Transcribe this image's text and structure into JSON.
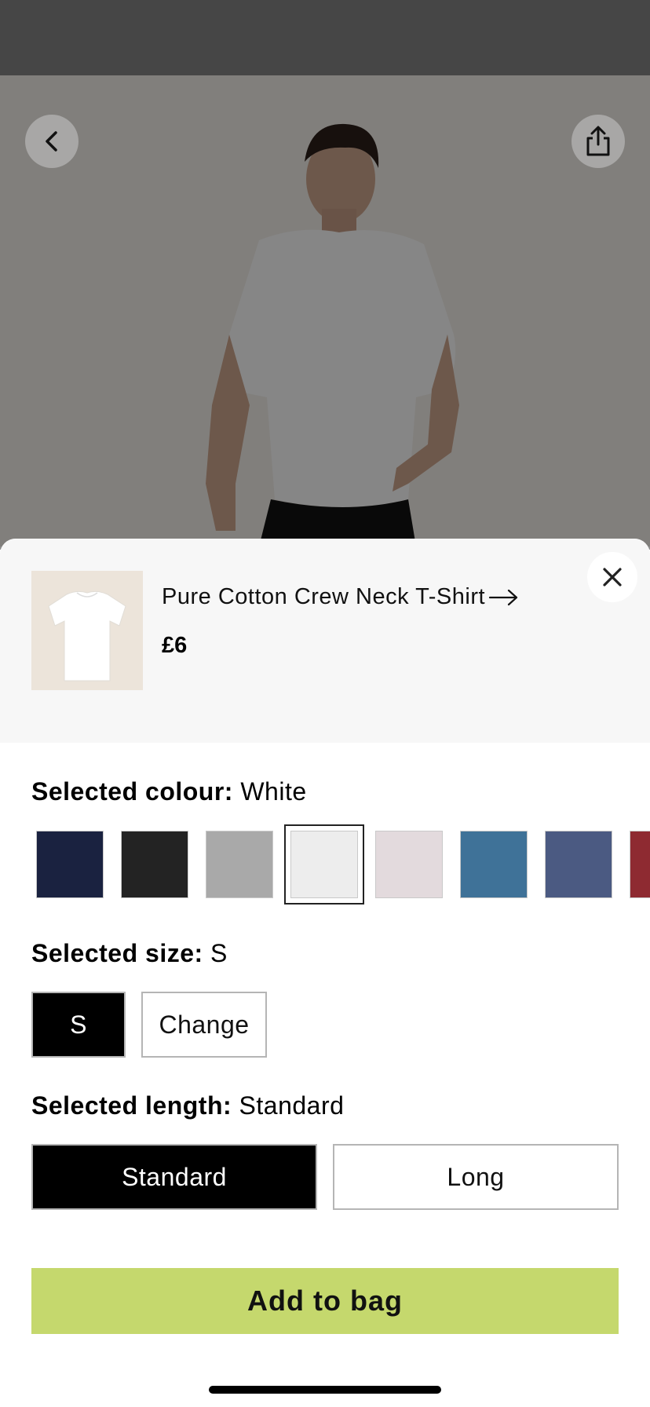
{
  "hero": {
    "image_alt": ""
  },
  "header_buttons": {
    "back_icon": "chevron-left-icon",
    "share_icon": "share-icon"
  },
  "product": {
    "name": "Pure Cotton Crew Neck T-Shirt",
    "price": "£6",
    "link_icon": "arrow-right-icon"
  },
  "colour": {
    "label": "Selected colour:",
    "value": "White",
    "swatches": [
      {
        "name": "navy",
        "color": "#1a2240"
      },
      {
        "name": "black",
        "color": "#232323"
      },
      {
        "name": "grey-marl",
        "color": "#a9a9a9"
      },
      {
        "name": "white",
        "color": "#ededed",
        "selected": true
      },
      {
        "name": "pale-pink",
        "color": "#e3dadd"
      },
      {
        "name": "blue",
        "color": "#3f7298"
      },
      {
        "name": "denim",
        "color": "#4b5a82"
      },
      {
        "name": "red",
        "color": "#8e2a31"
      }
    ]
  },
  "size": {
    "label": "Selected size:",
    "value": "S",
    "options": [
      "S",
      "Change"
    ]
  },
  "length": {
    "label": "Selected length:",
    "value": "Standard",
    "options": [
      "Standard",
      "Long"
    ]
  },
  "cta": {
    "add_to_bag": "Add to bag",
    "color": "#c5d86d"
  }
}
